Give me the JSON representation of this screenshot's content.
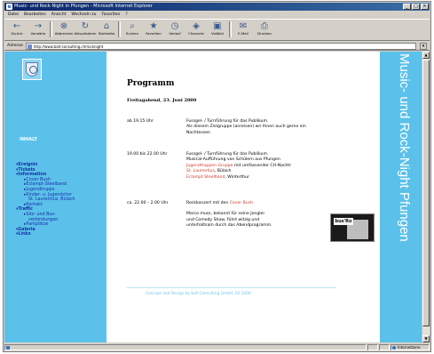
{
  "window": {
    "title": "Music- und Rock-Night in Pfungen - Microsoft Internet Explorer"
  },
  "menubar": [
    "Datei",
    "Bearbeiten",
    "Ansicht",
    "Wechseln zu",
    "Favoriten",
    "?"
  ],
  "toolbar": {
    "buttons": [
      {
        "label": "Zurück",
        "icon": "back-arrow-icon"
      },
      {
        "label": "Vorwärts",
        "icon": "forward-arrow-icon"
      },
      {
        "label": "Abbrechen",
        "icon": "stop-icon"
      },
      {
        "label": "Aktualisieren",
        "icon": "refresh-icon"
      },
      {
        "label": "Startseite",
        "icon": "home-icon"
      },
      {
        "label": "Suchen",
        "icon": "search-icon"
      },
      {
        "label": "Favoriten",
        "icon": "favorites-icon"
      },
      {
        "label": "Verlauf",
        "icon": "history-icon"
      },
      {
        "label": "Channels",
        "icon": "channels-icon"
      },
      {
        "label": "Vollbild",
        "icon": "fullscreen-icon"
      },
      {
        "label": "E-Mail",
        "icon": "mail-icon"
      },
      {
        "label": "Drucken",
        "icon": "print-icon"
      }
    ]
  },
  "address": {
    "label": "Adresse",
    "url": "http://www.ball-consulting.ch/rocknight"
  },
  "sidebar": {
    "heading": "INHALT",
    "nav": [
      {
        "label": "Ereignis",
        "level": 0
      },
      {
        "label": "Tickets",
        "level": 0
      },
      {
        "label": "Information",
        "level": 0
      },
      {
        "label": "Cover Bush",
        "level": 1
      },
      {
        "label": "Eclampt-Steelband",
        "level": 1
      },
      {
        "label": "Jugendtrupps",
        "level": 1
      },
      {
        "label": "Kinder- u. Jugendchor",
        "level": 1
      },
      {
        "label": "St. Laurentius, Bülach",
        "level": 2
      },
      {
        "label": "Kontakt",
        "level": 1
      },
      {
        "label": "Traffic",
        "level": 0
      },
      {
        "label": "Sitz- und Bus-",
        "level": 1
      },
      {
        "label": "verbindungen",
        "level": 2
      },
      {
        "label": "Parkplätze",
        "level": 1
      },
      {
        "label": "Galerie",
        "level": 0
      },
      {
        "label": "Links",
        "level": 0
      }
    ]
  },
  "main": {
    "title": "Programm",
    "date": "Freitagabend, 23. Juni 2000",
    "entries": [
      {
        "time": "ab 19.15 Uhr",
        "lines": [
          "Fussgel- / Turnführung für das Publikum.",
          "Als diesem Zielgruppe (anreisen) wir Ihnen auch gerne ein",
          "Nachtessen"
        ]
      },
      {
        "time": "19.00 bis 22.00 Uhr",
        "lines": [
          "Fussgel- / Turnführung für das Publikum.",
          "Musical-Aufführung von Schülern aus Pfungen"
        ],
        "hl1": "Jugendtruppen Gruppe",
        "after1": " mit umfassender CH-Nachtr",
        "hl2": "St. Laurentius",
        "after2": ", Bülach",
        "hl3": "Eclampt Steelband",
        "after3": ", Winterthur"
      },
      {
        "time": "ca. 22.00 – 2.00 Uhr",
        "line_before": "Rockkonzert mit den ",
        "band": "Cover Bush",
        "lines": [
          "Marco muss, bekannt für seine Jongler",
          "und Comedy Show, führt witzig und",
          "unterhaltsam durch das Abendprogramm."
        ]
      }
    ],
    "photo_sign": "bus'Ro",
    "footer": "Concept and Design by ball Consulting GmbH, 02.2000"
  },
  "band_text": "Music- und Rock-Night Pfungen",
  "status": {
    "zone": "Internetzone"
  },
  "colors": {
    "accent_blue": "#5bc1ea",
    "link_blue": "#1a2fa8",
    "highlight_red": "#d23a2a",
    "title_bar": "#0a246a"
  }
}
